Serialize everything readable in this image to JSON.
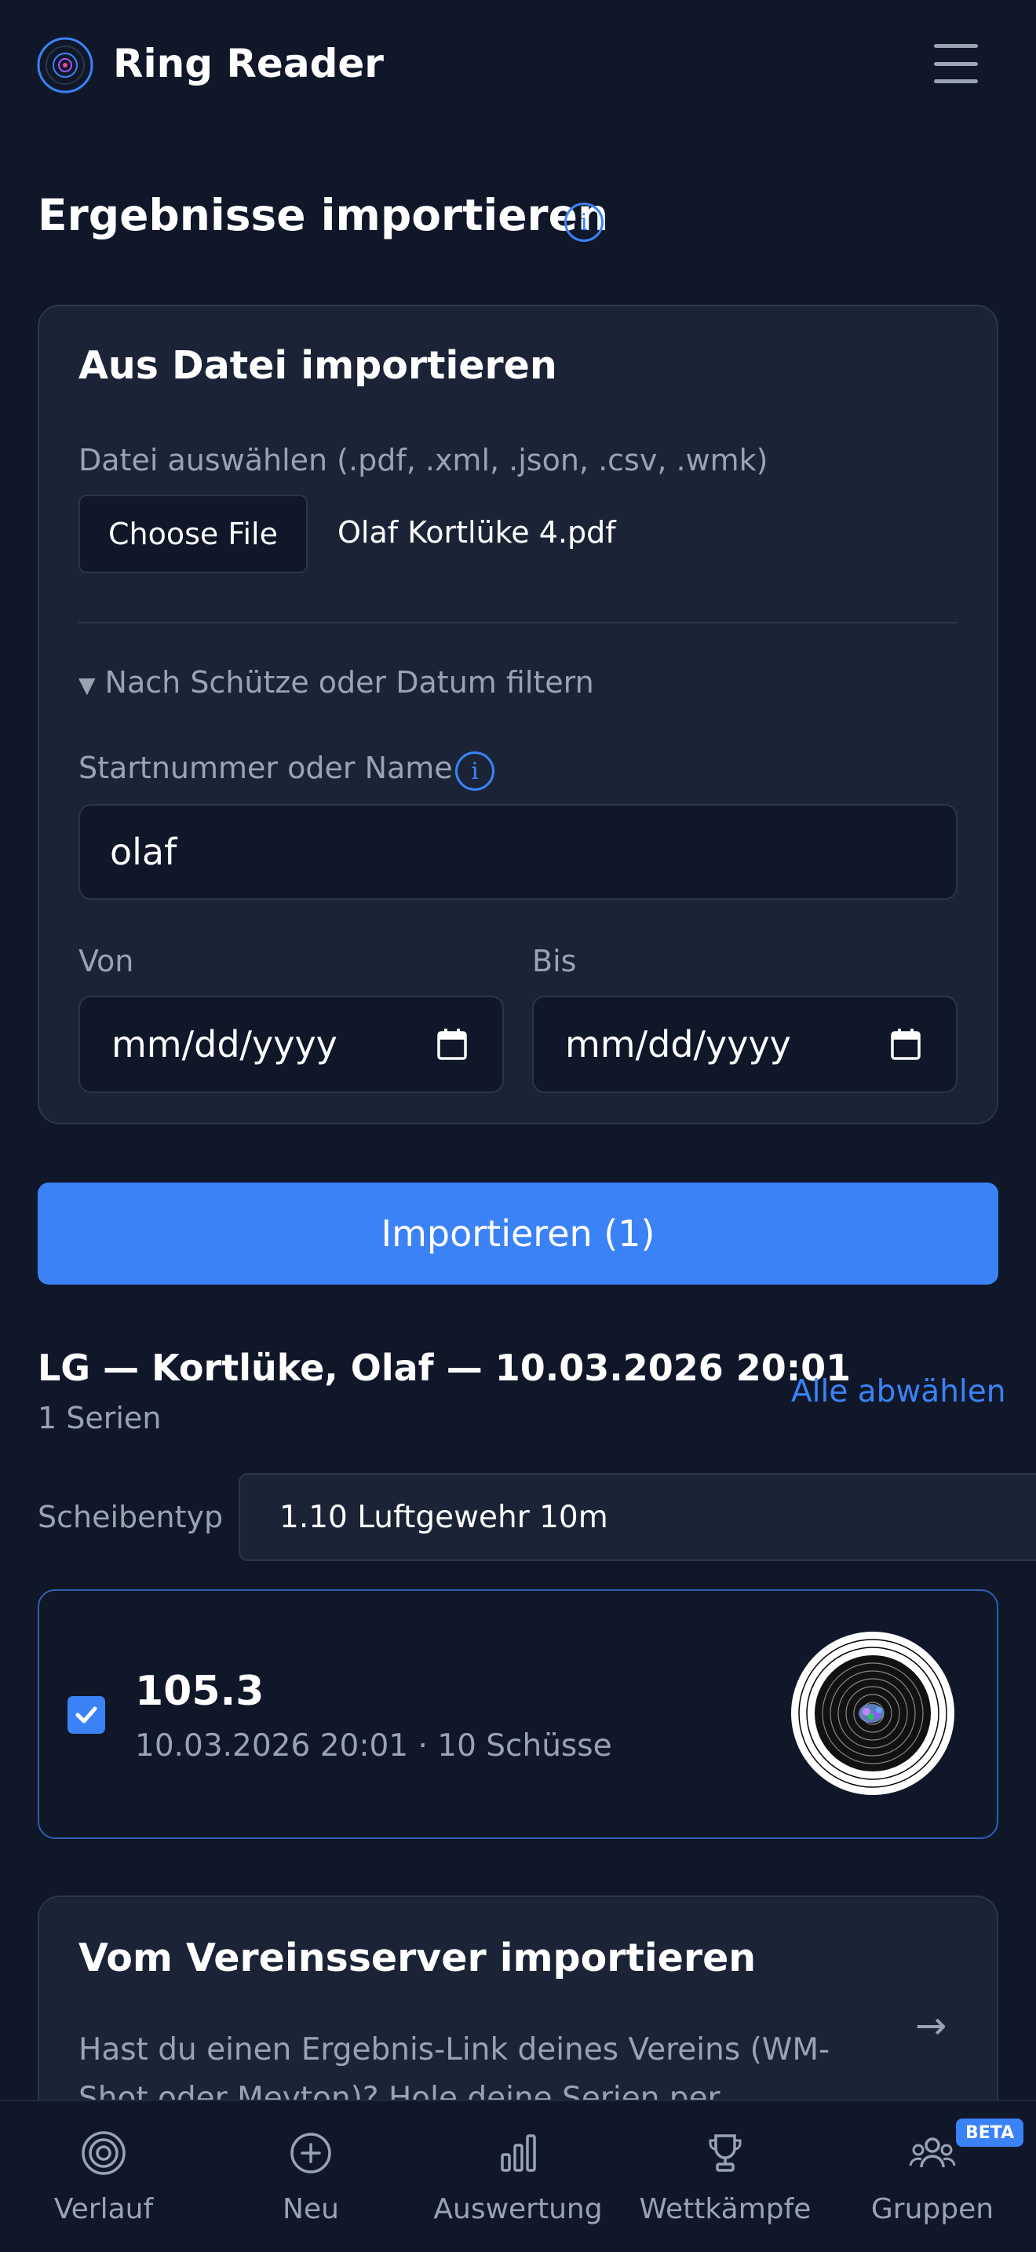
{
  "header": {
    "app_title": "Ring Reader",
    "logo_icon": "target-logo-icon",
    "menu_icon": "hamburger-menu-icon"
  },
  "page": {
    "title": "Ergebnisse importieren",
    "title_info_icon": "info-icon"
  },
  "file_import": {
    "title": "Aus Datei importieren",
    "file_label": "Datei auswählen (.pdf, .xml, .json, .csv, .wmk)",
    "choose_button": "Choose File",
    "file_name": "Olaf Kortlüke 4.pdf",
    "filter_toggle": "Nach Schütze oder Datum filtern",
    "name_label": "Startnummer oder Name",
    "name_value": "olaf",
    "from_label": "Von",
    "from_placeholder": "mm/dd/yyyy",
    "to_label": "Bis",
    "to_placeholder": "mm/dd/yyyy"
  },
  "import_button": "Importieren (1)",
  "result": {
    "heading": "LG — Kortlüke, Olaf — 10.03.2026 20:01",
    "subheading": "1 Serien",
    "deselect_link": "Alle abwählen",
    "target_type_label": "Scheibentyp",
    "target_type_value": "1.10 Luftgewehr 10m",
    "series": [
      {
        "score": "105.3",
        "meta": "10.03.2026 20:01 · 10 Schüsse",
        "checked": true
      }
    ]
  },
  "club_import": {
    "title": "Vom Vereinsserver importieren",
    "description": "Hast du einen Ergebnis-Link deines Vereins (WM-Shot oder Meyton)? Hole deine Serien per Startnummer",
    "arrow": "→"
  },
  "bottom_nav": {
    "items": [
      {
        "label": "Verlauf",
        "icon": "target-icon"
      },
      {
        "label": "Neu",
        "icon": "plus-circle-icon"
      },
      {
        "label": "Auswertung",
        "icon": "bar-chart-icon"
      },
      {
        "label": "Wettkämpfe",
        "icon": "trophy-icon"
      },
      {
        "label": "Gruppen",
        "icon": "group-icon"
      }
    ],
    "beta_badge": "BETA"
  },
  "colors": {
    "background": "#0f1729",
    "card": "#1a2436",
    "accent": "#3b82f6",
    "muted_text": "#9aa3b2"
  }
}
